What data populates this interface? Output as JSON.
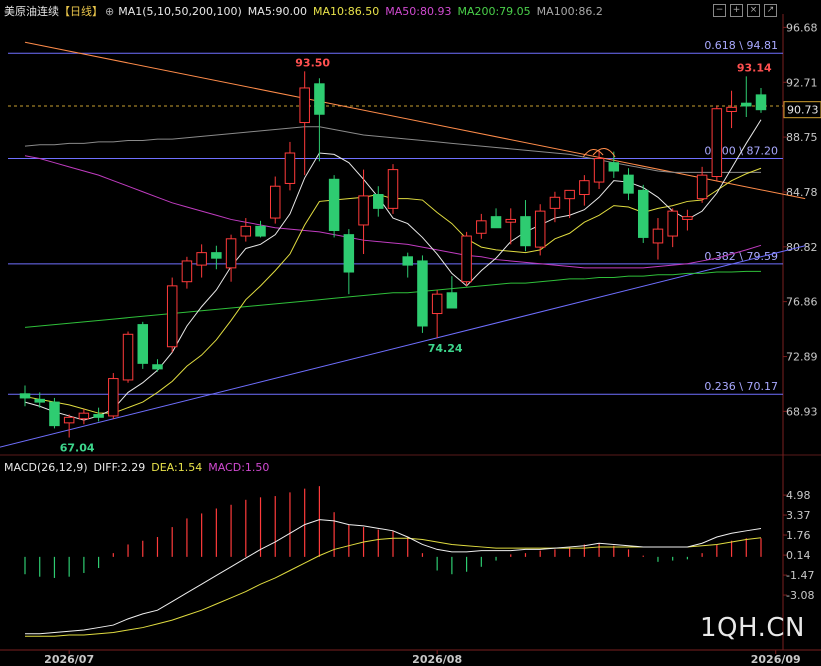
{
  "header": {
    "symbol": "美原油连续",
    "period": "【日线】",
    "ma_items": [
      {
        "label": "MA1(5,10,50,200,100)",
        "color": "#e8e8e8"
      },
      {
        "label": "MA5:90.00",
        "color": "#e8e8e8"
      },
      {
        "label": "MA10:86.50",
        "color": "#e8e24a"
      },
      {
        "label": "MA50:80.93",
        "color": "#d04ad0"
      },
      {
        "label": "MA200:79.05",
        "color": "#4ad04a"
      },
      {
        "label": "MA100:86.2",
        "color": "#a8a8a8"
      }
    ]
  },
  "macd_header": {
    "items": [
      {
        "label": "MACD(26,12,9)",
        "color": "#e8e8e8"
      },
      {
        "label": "DIFF:2.29",
        "color": "#e8e8e8"
      },
      {
        "label": "DEA:1.54",
        "color": "#e8e24a"
      },
      {
        "label": "MACD:1.50",
        "color": "#d04ad0"
      }
    ]
  },
  "watermark": "1QH.CN",
  "current_price_label": "90.73",
  "chart_data": [
    {
      "type": "candlestick",
      "ylim": [
        66.5,
        97.5
      ],
      "y_ticks": [
        "96.68",
        "92.71",
        "88.75",
        "84.78",
        "80.82",
        "76.86",
        "72.89",
        "68.93"
      ],
      "x_ticks": [
        {
          "label": "2026/07",
          "index": 3
        },
        {
          "label": "2026/08",
          "index": 28
        },
        {
          "label": "2026/09",
          "index": 51
        }
      ],
      "candles": [
        {
          "o": 70.2,
          "h": 70.8,
          "l": 69.3,
          "c": 69.9
        },
        {
          "o": 69.8,
          "h": 70.3,
          "l": 69.2,
          "c": 69.6
        },
        {
          "o": 69.6,
          "h": 69.9,
          "l": 67.7,
          "c": 67.9
        },
        {
          "o": 68.1,
          "h": 68.7,
          "l": 67.04,
          "c": 68.5
        },
        {
          "o": 68.4,
          "h": 69.1,
          "l": 68.0,
          "c": 68.8
        },
        {
          "o": 68.7,
          "h": 69.2,
          "l": 68.2,
          "c": 68.5
        },
        {
          "o": 68.6,
          "h": 71.7,
          "l": 68.4,
          "c": 71.3
        },
        {
          "o": 71.2,
          "h": 74.7,
          "l": 71.0,
          "c": 74.5
        },
        {
          "o": 75.2,
          "h": 75.4,
          "l": 72.0,
          "c": 72.4
        },
        {
          "o": 72.3,
          "h": 72.7,
          "l": 71.8,
          "c": 72.0
        },
        {
          "o": 73.6,
          "h": 78.6,
          "l": 73.2,
          "c": 78.0
        },
        {
          "o": 78.3,
          "h": 80.1,
          "l": 77.8,
          "c": 79.8
        },
        {
          "o": 79.5,
          "h": 81.0,
          "l": 78.6,
          "c": 80.4
        },
        {
          "o": 80.4,
          "h": 80.9,
          "l": 79.2,
          "c": 80.0
        },
        {
          "o": 79.3,
          "h": 81.7,
          "l": 78.3,
          "c": 81.4
        },
        {
          "o": 81.6,
          "h": 82.9,
          "l": 81.2,
          "c": 82.3
        },
        {
          "o": 82.3,
          "h": 82.7,
          "l": 81.5,
          "c": 81.6
        },
        {
          "o": 82.9,
          "h": 85.9,
          "l": 82.5,
          "c": 85.2
        },
        {
          "o": 85.4,
          "h": 88.4,
          "l": 84.9,
          "c": 87.6
        },
        {
          "o": 89.8,
          "h": 93.5,
          "l": 86.0,
          "c": 92.3
        },
        {
          "o": 92.6,
          "h": 93.0,
          "l": 87.0,
          "c": 90.4
        },
        {
          "o": 85.7,
          "h": 86.0,
          "l": 81.5,
          "c": 82.0
        },
        {
          "o": 81.7,
          "h": 82.1,
          "l": 77.4,
          "c": 79.0
        },
        {
          "o": 82.4,
          "h": 86.4,
          "l": 80.3,
          "c": 84.5
        },
        {
          "o": 84.6,
          "h": 85.2,
          "l": 83.0,
          "c": 83.6
        },
        {
          "o": 83.6,
          "h": 86.8,
          "l": 83.2,
          "c": 86.4
        },
        {
          "o": 80.1,
          "h": 80.4,
          "l": 78.6,
          "c": 79.5
        },
        {
          "o": 79.8,
          "h": 80.2,
          "l": 74.6,
          "c": 75.1
        },
        {
          "o": 76.0,
          "h": 77.7,
          "l": 74.24,
          "c": 77.4
        },
        {
          "o": 77.5,
          "h": 78.7,
          "l": 76.8,
          "c": 76.4
        },
        {
          "o": 78.3,
          "h": 81.9,
          "l": 78.0,
          "c": 81.6
        },
        {
          "o": 81.8,
          "h": 83.2,
          "l": 81.4,
          "c": 82.7
        },
        {
          "o": 83.0,
          "h": 83.6,
          "l": 82.2,
          "c": 82.2
        },
        {
          "o": 82.6,
          "h": 83.6,
          "l": 81.0,
          "c": 82.8
        },
        {
          "o": 83.0,
          "h": 84.2,
          "l": 80.5,
          "c": 80.9
        },
        {
          "o": 80.8,
          "h": 83.9,
          "l": 80.2,
          "c": 83.4
        },
        {
          "o": 83.6,
          "h": 84.8,
          "l": 82.6,
          "c": 84.4
        },
        {
          "o": 84.3,
          "h": 84.8,
          "l": 82.9,
          "c": 84.9
        },
        {
          "o": 84.6,
          "h": 86.0,
          "l": 83.8,
          "c": 85.6
        },
        {
          "o": 85.5,
          "h": 87.8,
          "l": 85.0,
          "c": 87.2
        },
        {
          "o": 86.9,
          "h": 87.7,
          "l": 85.8,
          "c": 86.3
        },
        {
          "o": 86.0,
          "h": 86.5,
          "l": 84.2,
          "c": 84.7
        },
        {
          "o": 84.9,
          "h": 85.3,
          "l": 81.1,
          "c": 81.5
        },
        {
          "o": 81.1,
          "h": 82.9,
          "l": 79.9,
          "c": 82.1
        },
        {
          "o": 81.6,
          "h": 83.6,
          "l": 80.8,
          "c": 83.4
        },
        {
          "o": 82.8,
          "h": 83.5,
          "l": 82.0,
          "c": 83.0
        },
        {
          "o": 84.3,
          "h": 86.6,
          "l": 84.0,
          "c": 86.0
        },
        {
          "o": 85.9,
          "h": 91.0,
          "l": 85.6,
          "c": 90.8
        },
        {
          "o": 90.6,
          "h": 92.1,
          "l": 89.4,
          "c": 90.9
        },
        {
          "o": 91.2,
          "h": 93.14,
          "l": 90.2,
          "c": 91.0
        },
        {
          "o": 91.8,
          "h": 92.3,
          "l": 90.5,
          "c": 90.73
        }
      ],
      "ma5": [
        69.6,
        69.3,
        68.9,
        68.6,
        68.3,
        68.6,
        69.1,
        70.3,
        71.0,
        71.9,
        73.2,
        75.1,
        76.5,
        77.7,
        79.4,
        80.7,
        81.0,
        81.7,
        83.2,
        85.8,
        87.6,
        87.5,
        86.9,
        85.7,
        84.4,
        82.9,
        82.5,
        81.5,
        80.3,
        78.9,
        78.0,
        79.1,
        80.0,
        81.2,
        81.9,
        82.4,
        82.9,
        83.1,
        83.5,
        84.4,
        85.6,
        85.5,
        85.1,
        84.4,
        83.4,
        82.8,
        83.4,
        84.7,
        86.5,
        88.3,
        90.0
      ],
      "ma10": [
        70.0,
        69.8,
        69.6,
        69.4,
        69.1,
        68.8,
        68.8,
        69.2,
        69.6,
        70.3,
        71.1,
        72.2,
        73.0,
        74.1,
        75.5,
        77.0,
        78.0,
        79.1,
        80.3,
        82.4,
        84.1,
        84.2,
        84.3,
        84.4,
        84.6,
        84.3,
        84.3,
        84.2,
        83.3,
        82.5,
        81.4,
        80.8,
        80.6,
        80.5,
        80.4,
        80.6,
        81.4,
        81.8,
        82.6,
        83.1,
        83.8,
        83.7,
        83.3,
        83.6,
        83.8,
        84.1,
        84.2,
        84.9,
        85.6,
        86.1,
        86.5
      ],
      "ma50": [
        87.4,
        87.2,
        86.9,
        86.6,
        86.3,
        86.0,
        85.6,
        85.2,
        84.8,
        84.4,
        84.0,
        83.7,
        83.4,
        83.1,
        82.8,
        82.6,
        82.4,
        82.2,
        82.1,
        82.0,
        81.9,
        81.7,
        81.5,
        81.3,
        81.2,
        81.1,
        81.0,
        80.8,
        80.6,
        80.4,
        80.2,
        80.1,
        79.9,
        79.8,
        79.7,
        79.6,
        79.5,
        79.4,
        79.3,
        79.3,
        79.3,
        79.3,
        79.3,
        79.4,
        79.5,
        79.6,
        79.8,
        80.0,
        80.3,
        80.6,
        80.93
      ],
      "ma100": [
        88.1,
        88.2,
        88.2,
        88.3,
        88.3,
        88.4,
        88.4,
        88.5,
        88.5,
        88.6,
        88.6,
        88.7,
        88.8,
        88.9,
        89.0,
        89.1,
        89.2,
        89.3,
        89.4,
        89.5,
        89.5,
        89.3,
        89.1,
        88.9,
        88.8,
        88.7,
        88.6,
        88.5,
        88.4,
        88.3,
        88.2,
        88.1,
        88.0,
        87.9,
        87.8,
        87.7,
        87.6,
        87.5,
        87.3,
        87.1,
        86.9,
        86.7,
        86.5,
        86.3,
        86.2,
        86.2,
        86.2,
        86.2,
        86.2,
        86.2,
        86.2
      ],
      "ma200": [
        75.0,
        75.1,
        75.2,
        75.3,
        75.4,
        75.5,
        75.6,
        75.7,
        75.8,
        75.9,
        76.0,
        76.1,
        76.2,
        76.3,
        76.4,
        76.5,
        76.6,
        76.7,
        76.8,
        76.9,
        77.0,
        77.1,
        77.2,
        77.3,
        77.4,
        77.5,
        77.5,
        77.6,
        77.7,
        77.8,
        77.9,
        78.0,
        78.1,
        78.2,
        78.2,
        78.3,
        78.4,
        78.5,
        78.5,
        78.6,
        78.6,
        78.7,
        78.7,
        78.8,
        78.8,
        78.9,
        78.9,
        79.0,
        79.0,
        79.05,
        79.05
      ],
      "fib_levels": [
        {
          "ratio": "0.618",
          "value": 94.81,
          "label": "0.618 \\ 94.81"
        },
        {
          "ratio": "0.500",
          "value": 87.2,
          "label": "0.500 \\ 87.20"
        },
        {
          "ratio": "0.382",
          "value": 79.59,
          "label": "0.382 \\ 79.59"
        },
        {
          "ratio": "0.236",
          "value": 70.17,
          "label": "0.236 \\ 70.17"
        }
      ],
      "annotations": [
        {
          "label": "93.50",
          "index": 19,
          "value": 93.5,
          "pos": "above",
          "color": "#ff5050"
        },
        {
          "label": "67.04",
          "index": 3,
          "value": 67.04,
          "pos": "below",
          "color": "#3dd68c"
        },
        {
          "label": "74.24",
          "index": 28,
          "value": 74.24,
          "pos": "below",
          "color": "#3dd68c"
        },
        {
          "label": "93.14",
          "index": 49,
          "value": 93.14,
          "pos": "above",
          "color": "#ff5050"
        }
      ],
      "trendlines": [
        {
          "name": "resistance",
          "from": [
            0,
            95.6
          ],
          "to": [
            53,
            84.3
          ],
          "color": "#ff8c4a"
        },
        {
          "name": "support",
          "from": [
            -6,
            65.2
          ],
          "to": [
            53,
            80.9
          ],
          "color": "#6f6fff"
        }
      ],
      "current_price": 90.73,
      "current_price_prev_close": 91.0
    },
    {
      "type": "bar",
      "name": "MACD",
      "ylim": [
        -6.3,
        6.6
      ],
      "y_ticks": [
        "4.98",
        "3.37",
        "1.76",
        "0.14",
        "-1.47",
        "-3.08"
      ],
      "hist": [
        -1.4,
        -1.6,
        -1.7,
        -1.6,
        -1.3,
        -0.9,
        0.3,
        1.0,
        1.3,
        1.6,
        2.4,
        3.1,
        3.5,
        3.9,
        4.2,
        4.6,
        4.8,
        4.9,
        5.2,
        5.5,
        5.7,
        3.6,
        2.6,
        2.4,
        2.2,
        2.1,
        1.6,
        0.3,
        -1.1,
        -1.4,
        -1.2,
        -0.8,
        -0.3,
        0.2,
        0.3,
        0.5,
        0.6,
        0.8,
        1.0,
        1.1,
        0.9,
        0.6,
        0.1,
        -0.4,
        -0.3,
        -0.2,
        0.3,
        1.0,
        1.3,
        1.5,
        1.5
      ],
      "diff": [
        -6.2,
        -6.2,
        -6.1,
        -6.0,
        -5.9,
        -5.7,
        -5.5,
        -5.0,
        -4.6,
        -4.3,
        -3.6,
        -2.9,
        -2.2,
        -1.5,
        -0.8,
        -0.1,
        0.6,
        1.2,
        1.9,
        2.6,
        3.0,
        2.9,
        2.6,
        2.5,
        2.3,
        2.1,
        1.6,
        1.0,
        0.6,
        0.4,
        0.4,
        0.5,
        0.5,
        0.5,
        0.6,
        0.6,
        0.7,
        0.8,
        0.9,
        1.1,
        1.0,
        0.9,
        0.8,
        0.8,
        0.8,
        0.8,
        1.1,
        1.6,
        1.9,
        2.1,
        2.29
      ],
      "dea": [
        -6.4,
        -6.4,
        -6.4,
        -6.3,
        -6.3,
        -6.2,
        -6.1,
        -5.9,
        -5.7,
        -5.4,
        -5.1,
        -4.7,
        -4.3,
        -3.8,
        -3.3,
        -2.8,
        -2.2,
        -1.7,
        -1.1,
        -0.5,
        0.1,
        0.6,
        0.9,
        1.2,
        1.4,
        1.5,
        1.5,
        1.4,
        1.2,
        1.0,
        0.9,
        0.8,
        0.7,
        0.7,
        0.7,
        0.7,
        0.7,
        0.7,
        0.7,
        0.8,
        0.8,
        0.8,
        0.8,
        0.8,
        0.8,
        0.8,
        0.9,
        1.0,
        1.2,
        1.4,
        1.54
      ],
      "zero_line": true
    }
  ]
}
